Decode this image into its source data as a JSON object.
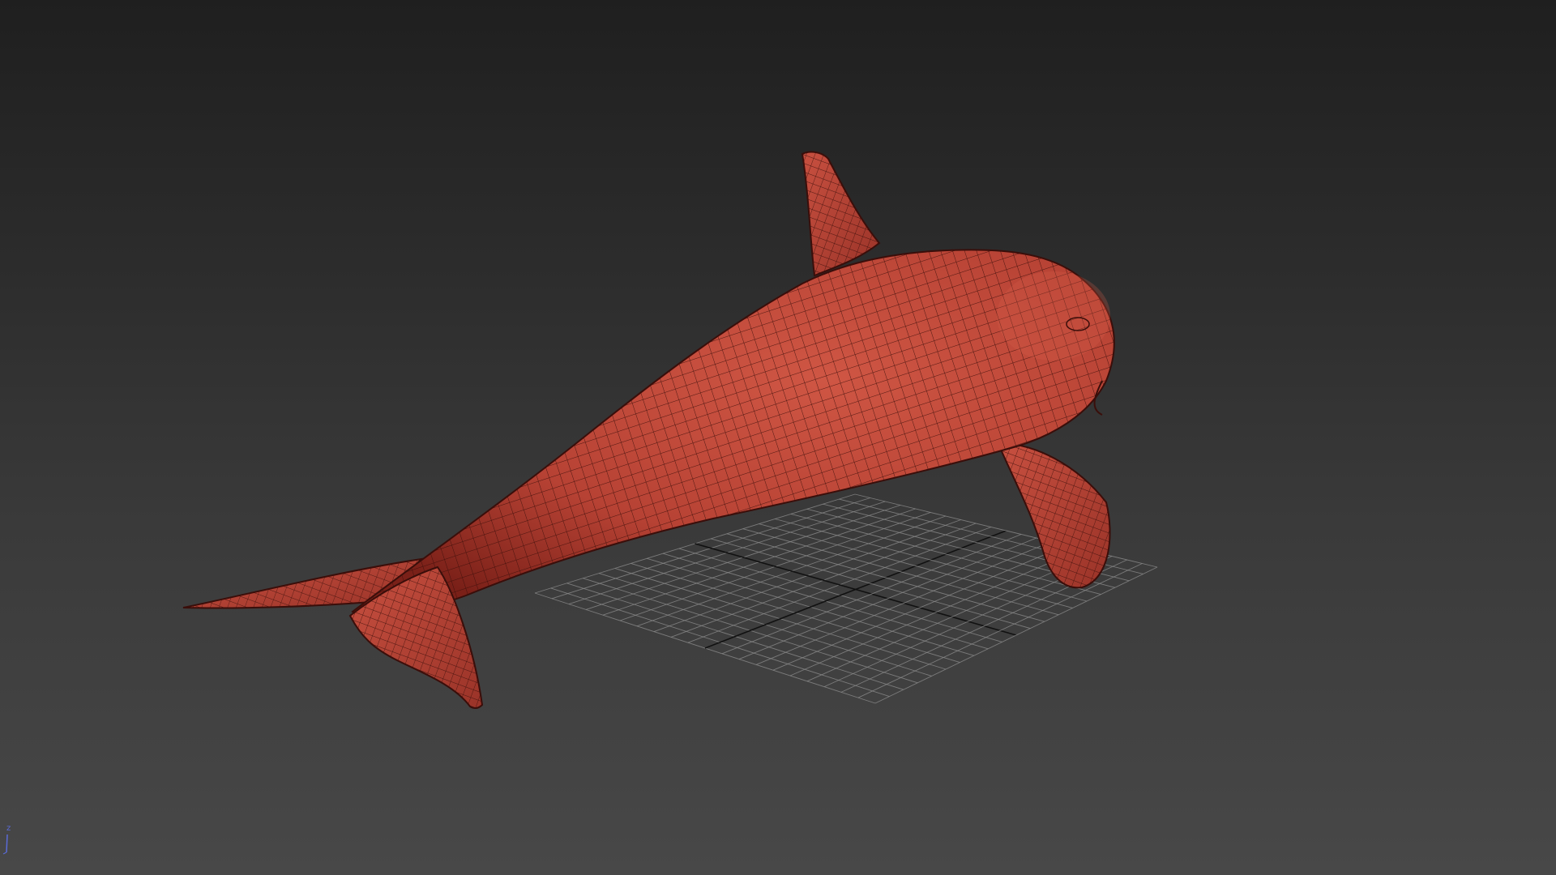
{
  "viewport": {
    "background_top": "#1f1f1f",
    "background_bottom": "#484848",
    "grid_color": "#8a8a8a",
    "grid_axis_color": "#111111"
  },
  "model": {
    "name": "orca",
    "shading": "edged-faces",
    "color": "#c24a3a",
    "wire_color": "#3a0e0a"
  },
  "axis_gizmo": {
    "z_label": "z",
    "color": "#5a6bd8",
    "icon": "axis-tripod-icon"
  }
}
